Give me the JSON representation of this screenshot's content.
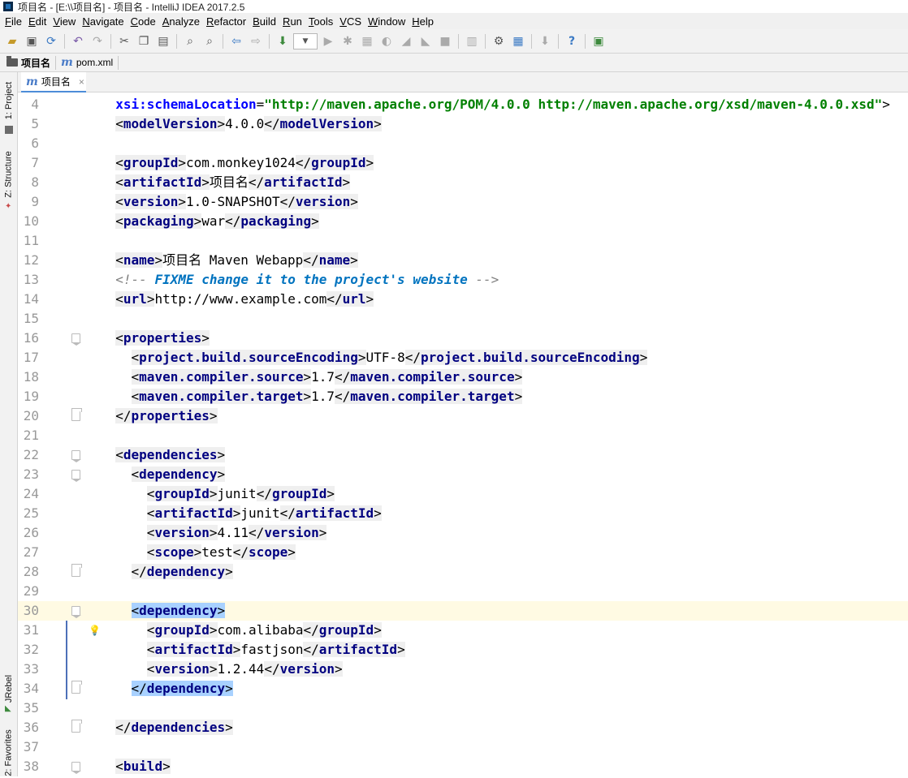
{
  "window": {
    "title": "项目名 - [E:\\\\项目名] - 项目名 - IntelliJ IDEA 2017.2.5"
  },
  "menu": [
    {
      "label": "File"
    },
    {
      "label": "Edit"
    },
    {
      "label": "View"
    },
    {
      "label": "Navigate"
    },
    {
      "label": "Code"
    },
    {
      "label": "Analyze"
    },
    {
      "label": "Refactor"
    },
    {
      "label": "Build"
    },
    {
      "label": "Run"
    },
    {
      "label": "Tools"
    },
    {
      "label": "VCS"
    },
    {
      "label": "Window"
    },
    {
      "label": "Help"
    }
  ],
  "toolbar": {
    "icons": [
      "open-icon",
      "save-icon",
      "sync-icon",
      "undo-icon",
      "redo-icon",
      "cut-icon",
      "copy-icon",
      "paste-icon",
      "find-icon",
      "replace-icon",
      "back-icon",
      "forward-icon",
      "build-icon",
      "run-config-dropdown",
      "run-icon",
      "debug-icon",
      "coverage-icon",
      "profile-icon",
      "jrebel-run-icon",
      "jrebel-debug-icon",
      "stop-icon",
      "project-structure-icon",
      "settings-icon",
      "sdk-icon",
      "vcs-icon",
      "help-icon",
      "plugin-icon"
    ]
  },
  "navbar": {
    "crumbs": [
      {
        "label": "项目名",
        "icon": "folder-icon"
      },
      {
        "label": "pom.xml",
        "icon": "maven-icon"
      }
    ]
  },
  "sidebar": {
    "tabs": [
      {
        "label": "1: Project"
      },
      {
        "label": "Z: Structure"
      },
      {
        "label": "JRebel"
      },
      {
        "label": "2: Favorites"
      }
    ]
  },
  "editor": {
    "tab": {
      "label": "项目名",
      "close": "×"
    },
    "caret_line": 30,
    "lines": [
      {
        "n": "4",
        "parts": [
          {
            "t": "  "
          },
          {
            "c": "an",
            "t": "xsi:schemaLocation"
          },
          {
            "t": "="
          },
          {
            "c": "av",
            "t": "\"http://maven.apache.org/POM/4.0.0 http://maven.apache.org/xsd/maven-4.0.0.xsd\""
          },
          {
            "t": ">"
          }
        ]
      },
      {
        "n": "5",
        "parts": [
          {
            "t": "  "
          },
          {
            "c": "tag",
            "t": "<modelVersion>"
          },
          {
            "t": "4.0.0"
          },
          {
            "c": "tag",
            "t": "</modelVersion>"
          }
        ]
      },
      {
        "n": "6",
        "parts": []
      },
      {
        "n": "7",
        "parts": [
          {
            "t": "  "
          },
          {
            "c": "tag",
            "t": "<groupId>"
          },
          {
            "t": "com.monkey1024"
          },
          {
            "c": "tag",
            "t": "</groupId>"
          }
        ]
      },
      {
        "n": "8",
        "parts": [
          {
            "t": "  "
          },
          {
            "c": "tag",
            "t": "<artifactId>"
          },
          {
            "t": "项目名"
          },
          {
            "c": "tag",
            "t": "</artifactId>"
          }
        ]
      },
      {
        "n": "9",
        "parts": [
          {
            "t": "  "
          },
          {
            "c": "tag",
            "t": "<version>"
          },
          {
            "t": "1.0-SNAPSHOT"
          },
          {
            "c": "tag",
            "t": "</version>"
          }
        ]
      },
      {
        "n": "10",
        "parts": [
          {
            "t": "  "
          },
          {
            "c": "tag",
            "t": "<packaging>"
          },
          {
            "t": "war"
          },
          {
            "c": "tag",
            "t": "</packaging>"
          }
        ]
      },
      {
        "n": "11",
        "parts": []
      },
      {
        "n": "12",
        "parts": [
          {
            "t": "  "
          },
          {
            "c": "tag",
            "t": "<name>"
          },
          {
            "t": "项目名 Maven Webapp"
          },
          {
            "c": "tag",
            "t": "</name>"
          }
        ]
      },
      {
        "n": "13",
        "parts": [
          {
            "t": "  "
          },
          {
            "c": "cm",
            "t": "<!-- "
          },
          {
            "c": "td",
            "t": "FIXME change it to the project's website"
          },
          {
            "c": "cm",
            "t": " -->"
          }
        ]
      },
      {
        "n": "14",
        "parts": [
          {
            "t": "  "
          },
          {
            "c": "tag",
            "t": "<url>"
          },
          {
            "t": "http://www.example.com"
          },
          {
            "c": "tag",
            "t": "</url>"
          }
        ]
      },
      {
        "n": "15",
        "parts": []
      },
      {
        "n": "16",
        "fold": "start",
        "parts": [
          {
            "t": "  "
          },
          {
            "c": "tag",
            "t": "<properties>"
          }
        ]
      },
      {
        "n": "17",
        "parts": [
          {
            "t": "    "
          },
          {
            "c": "tag",
            "t": "<project.build.sourceEncoding>"
          },
          {
            "t": "UTF-8"
          },
          {
            "c": "tag",
            "t": "</project.build.sourceEncoding>"
          }
        ]
      },
      {
        "n": "18",
        "parts": [
          {
            "t": "    "
          },
          {
            "c": "tag",
            "t": "<maven.compiler.source>"
          },
          {
            "t": "1.7"
          },
          {
            "c": "tag",
            "t": "</maven.compiler.source>"
          }
        ]
      },
      {
        "n": "19",
        "parts": [
          {
            "t": "    "
          },
          {
            "c": "tag",
            "t": "<maven.compiler.target>"
          },
          {
            "t": "1.7"
          },
          {
            "c": "tag",
            "t": "</maven.compiler.target>"
          }
        ]
      },
      {
        "n": "20",
        "fold": "end",
        "parts": [
          {
            "t": "  "
          },
          {
            "c": "tag",
            "t": "</properties>"
          }
        ]
      },
      {
        "n": "21",
        "parts": []
      },
      {
        "n": "22",
        "fold": "start",
        "parts": [
          {
            "t": "  "
          },
          {
            "c": "tag",
            "t": "<dependencies>"
          }
        ]
      },
      {
        "n": "23",
        "fold": "start",
        "parts": [
          {
            "t": "    "
          },
          {
            "c": "tag",
            "t": "<dependency>"
          }
        ]
      },
      {
        "n": "24",
        "parts": [
          {
            "t": "      "
          },
          {
            "c": "tag",
            "t": "<groupId>"
          },
          {
            "t": "junit"
          },
          {
            "c": "tag",
            "t": "</groupId>"
          }
        ]
      },
      {
        "n": "25",
        "parts": [
          {
            "t": "      "
          },
          {
            "c": "tag",
            "t": "<artifactId>"
          },
          {
            "t": "junit"
          },
          {
            "c": "tag",
            "t": "</artifactId>"
          }
        ]
      },
      {
        "n": "26",
        "parts": [
          {
            "t": "      "
          },
          {
            "c": "tag",
            "t": "<version>"
          },
          {
            "t": "4.11"
          },
          {
            "c": "tag",
            "t": "</version>"
          }
        ]
      },
      {
        "n": "27",
        "parts": [
          {
            "t": "      "
          },
          {
            "c": "tag",
            "t": "<scope>"
          },
          {
            "t": "test"
          },
          {
            "c": "tag",
            "t": "</scope>"
          }
        ]
      },
      {
        "n": "28",
        "fold": "end",
        "parts": [
          {
            "t": "    "
          },
          {
            "c": "tag",
            "t": "</dependency>"
          }
        ]
      },
      {
        "n": "29",
        "parts": []
      },
      {
        "n": "30",
        "fold": "start",
        "hl": true,
        "parts": [
          {
            "t": "    "
          },
          {
            "c": "sel",
            "t": "<dependency>"
          }
        ]
      },
      {
        "n": "31",
        "bulb": true,
        "parts": [
          {
            "t": "      "
          },
          {
            "c": "tag",
            "t": "<groupId>"
          },
          {
            "t": "com.alibaba"
          },
          {
            "c": "tag",
            "t": "</groupId>"
          }
        ]
      },
      {
        "n": "32",
        "parts": [
          {
            "t": "      "
          },
          {
            "c": "tag",
            "t": "<artifactId>"
          },
          {
            "t": "fastjson"
          },
          {
            "c": "tag",
            "t": "</artifactId>"
          }
        ]
      },
      {
        "n": "33",
        "parts": [
          {
            "t": "      "
          },
          {
            "c": "tag",
            "t": "<version>"
          },
          {
            "t": "1.2.44"
          },
          {
            "c": "tag",
            "t": "</version>"
          }
        ]
      },
      {
        "n": "34",
        "fold": "end",
        "parts": [
          {
            "t": "    "
          },
          {
            "c": "sel",
            "t": "</dependency>"
          }
        ]
      },
      {
        "n": "35",
        "parts": []
      },
      {
        "n": "36",
        "fold": "end",
        "parts": [
          {
            "t": "  "
          },
          {
            "c": "tag",
            "t": "</dependencies>"
          }
        ]
      },
      {
        "n": "37",
        "parts": []
      },
      {
        "n": "38",
        "fold": "start",
        "parts": [
          {
            "t": "  "
          },
          {
            "c": "tag",
            "t": "<build>"
          }
        ]
      }
    ]
  },
  "colors": {
    "tag_name": "#000080",
    "attr_name": "#0000ff",
    "attr_value": "#008000",
    "comment": "#808080",
    "todo": "#0073bf",
    "caret_line_bg": "#fffae3",
    "selection": "#a8d1ff"
  }
}
